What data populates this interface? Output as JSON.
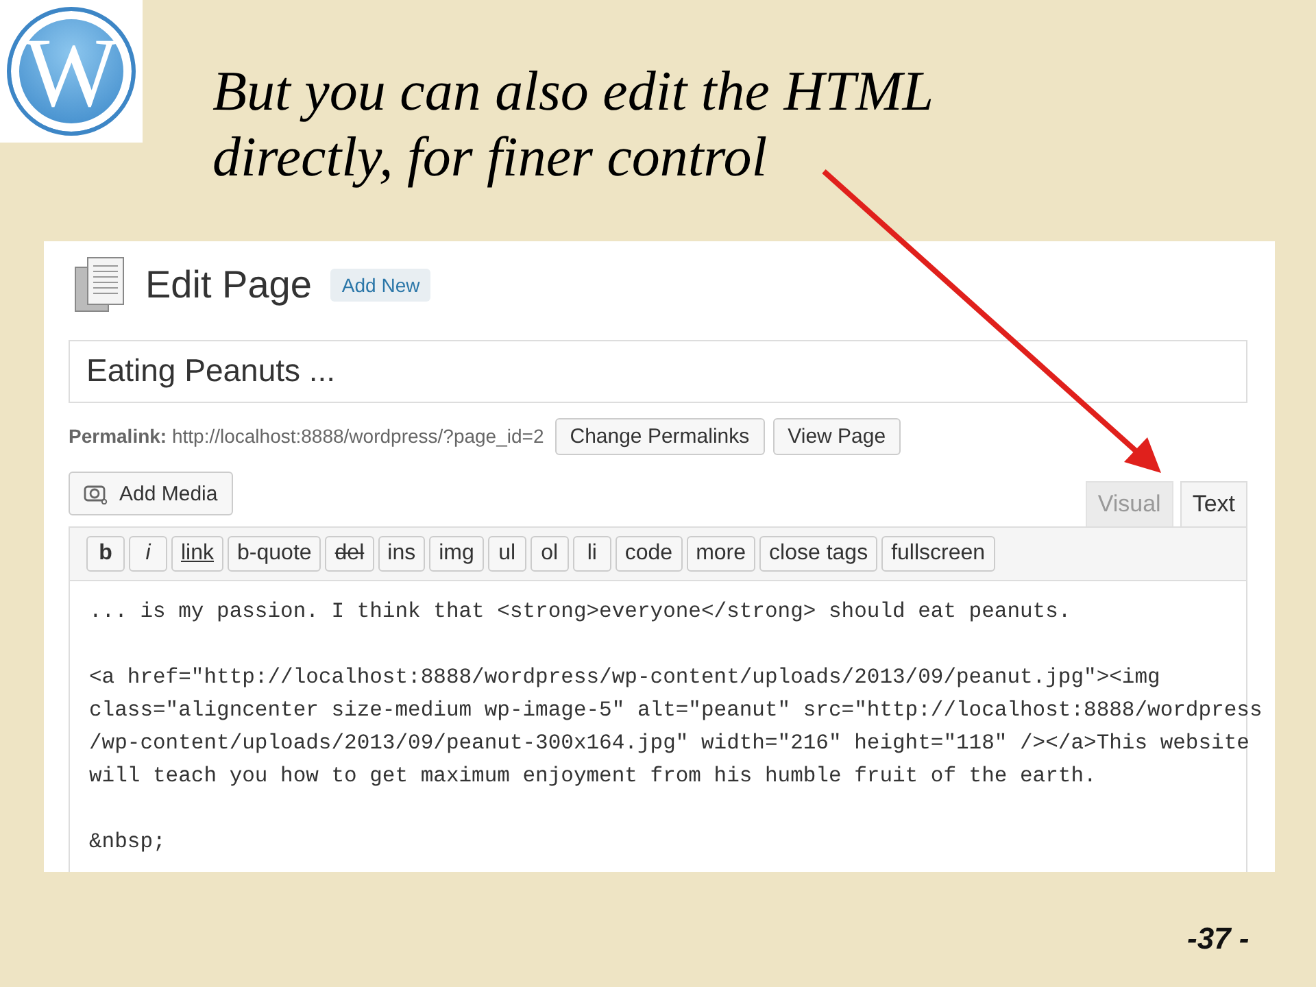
{
  "logo": {
    "letter": "W"
  },
  "slide_title": [
    "But you can also edit the HTML",
    "directly, for finer control"
  ],
  "screenshot": {
    "heading": "Edit Page",
    "add_new": "Add New",
    "title_value": "Eating Peanuts ...",
    "permalink_label": "Permalink:",
    "permalink_url": "http://localhost:8888/wordpress/?page_id=2",
    "permalink_buttons": [
      "Change Permalinks",
      "View Page"
    ],
    "add_media": "Add Media",
    "tabs": [
      {
        "label": "Visual",
        "selected": false
      },
      {
        "label": "Text",
        "selected": true
      }
    ],
    "toolbar": [
      {
        "label": "b",
        "kind": "bold"
      },
      {
        "label": "i",
        "kind": "italic"
      },
      {
        "label": "link",
        "kind": "underline"
      },
      {
        "label": "b-quote",
        "kind": "plain"
      },
      {
        "label": "del",
        "kind": "strike"
      },
      {
        "label": "ins",
        "kind": "plain"
      },
      {
        "label": "img",
        "kind": "plain"
      },
      {
        "label": "ul",
        "kind": "plain"
      },
      {
        "label": "ol",
        "kind": "plain"
      },
      {
        "label": "li",
        "kind": "plain"
      },
      {
        "label": "code",
        "kind": "plain"
      },
      {
        "label": "more",
        "kind": "plain"
      },
      {
        "label": "close tags",
        "kind": "plain"
      },
      {
        "label": "fullscreen",
        "kind": "plain"
      }
    ],
    "code_paragraphs": [
      [
        "... is my passion. I think that <strong>everyone</strong> should eat peanuts."
      ],
      [
        "<a href=\"http://localhost:8888/wordpress/wp-content/uploads/2013/09/peanut.jpg\"><img",
        "class=\"aligncenter size-medium wp-image-5\" alt=\"peanut\" src=\"http://localhost:8888/wordpress",
        "/wp-content/uploads/2013/09/peanut-300x164.jpg\" width=\"216\" height=\"118\" /></a>This website",
        "will teach you how to get maximum enjoyment from his humble fruit of the earth."
      ],
      [
        "&nbsp;"
      ]
    ]
  },
  "page_number": "-37 -"
}
